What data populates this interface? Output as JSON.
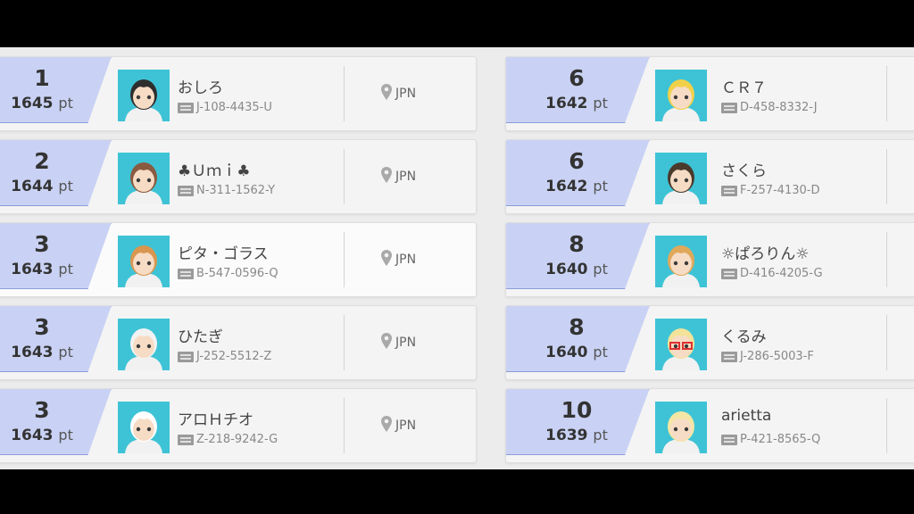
{
  "pt_unit": "pt",
  "accent_color": "#c9d2f4",
  "avatar_bg": "#3ec3d6",
  "left_column": [
    {
      "rank": "1",
      "points": "1645",
      "name": "おしろ",
      "trainer_id": "J-108-4435-U",
      "location": "JPN"
    },
    {
      "rank": "2",
      "points": "1644",
      "name": "♣Ｕｍｉ♣",
      "trainer_id": "N-311-1562-Y",
      "location": "JPN"
    },
    {
      "rank": "3",
      "points": "1643",
      "name": "ピタ・ゴラス",
      "trainer_id": "B-547-0596-Q",
      "location": "JPN"
    },
    {
      "rank": "3",
      "points": "1643",
      "name": "ひたぎ",
      "trainer_id": "J-252-5512-Z",
      "location": "JPN"
    },
    {
      "rank": "3",
      "points": "1643",
      "name": "アロＨチオ",
      "trainer_id": "Z-218-9242-G",
      "location": "JPN"
    }
  ],
  "right_column": [
    {
      "rank": "6",
      "points": "1642",
      "name": "ＣＲ７",
      "trainer_id": "D-458-8332-J"
    },
    {
      "rank": "6",
      "points": "1642",
      "name": "さくら",
      "trainer_id": "F-257-4130-D"
    },
    {
      "rank": "8",
      "points": "1640",
      "name": "☼ぱろりん☼",
      "trainer_id": "D-416-4205-G"
    },
    {
      "rank": "8",
      "points": "1640",
      "name": "くるみ",
      "trainer_id": "J-286-5003-F"
    },
    {
      "rank": "10",
      "points": "1639",
      "name": "arietta",
      "trainer_id": "P-421-8565-Q"
    }
  ]
}
